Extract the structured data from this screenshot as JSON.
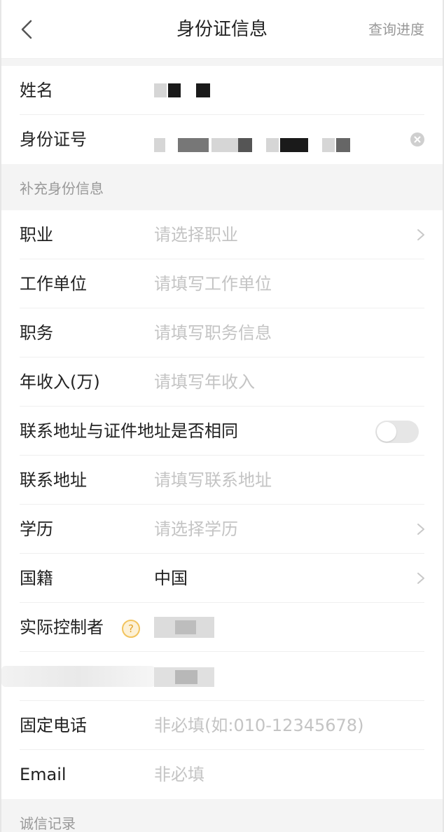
{
  "nav": {
    "title": "身份证信息",
    "right_action": "查询进度"
  },
  "basic": {
    "name_label": "姓名",
    "id_label": "身份证号"
  },
  "supplement": {
    "section_label": "补充身份信息",
    "occupation": {
      "label": "职业",
      "placeholder": "请选择职业"
    },
    "employer": {
      "label": "工作单位",
      "placeholder": "请填写工作单位"
    },
    "position": {
      "label": "职务",
      "placeholder": "请填写职务信息"
    },
    "income": {
      "label": "年收入(万)",
      "placeholder": "请填写年收入"
    },
    "same_address": {
      "label": "联系地址与证件地址是否相同",
      "enabled": false
    },
    "address": {
      "label": "联系地址",
      "placeholder": "请填写联系地址"
    },
    "education": {
      "label": "学历",
      "placeholder": "请选择学历"
    },
    "nationality": {
      "label": "国籍",
      "value": "中国"
    },
    "controller": {
      "label": "实际控制者",
      "help_glyph": "?"
    },
    "landline": {
      "label": "固定电话",
      "placeholder": "非必填(如:010-12345678)"
    },
    "email": {
      "label": "Email",
      "placeholder": "非必填"
    }
  },
  "credit": {
    "section_label": "诚信记录"
  }
}
